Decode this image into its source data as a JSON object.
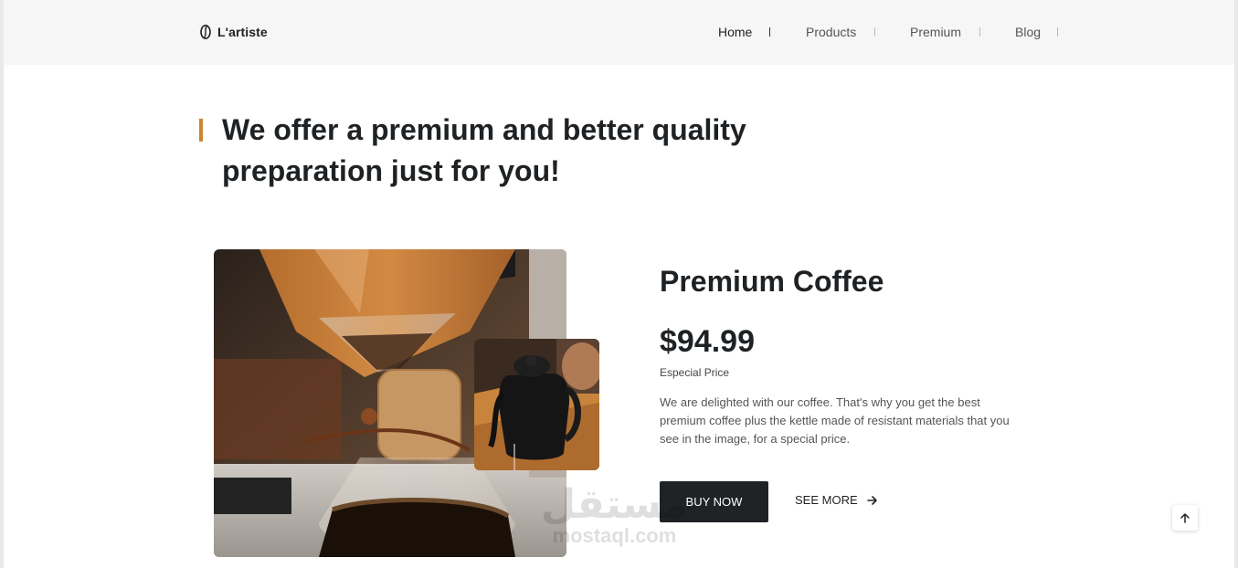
{
  "brand": {
    "name": "L'artiste",
    "icon": "coffee-bean-icon"
  },
  "nav": {
    "items": [
      {
        "label": "Home",
        "active": true
      },
      {
        "label": "Products",
        "active": false
      },
      {
        "label": "Premium",
        "active": false
      },
      {
        "label": "Blog",
        "active": false
      }
    ]
  },
  "hero": {
    "headline": "We offer a premium and better quality preparation just for you!"
  },
  "product": {
    "title": "Premium Coffee",
    "price": "$94.99",
    "price_label": "Especial Price",
    "description": "We are delighted with our coffee. That's why you get the best premium coffee plus the kettle made of resistant materials that you see in the image, for a special price.",
    "buy_label": "BUY NOW",
    "more_label": "SEE MORE"
  },
  "watermark": {
    "arabic": "مستقل",
    "latin": "mostaql.com"
  },
  "colors": {
    "accent": "#c8862d",
    "button": "#1f2326",
    "header_bg": "#f6f6f6"
  }
}
